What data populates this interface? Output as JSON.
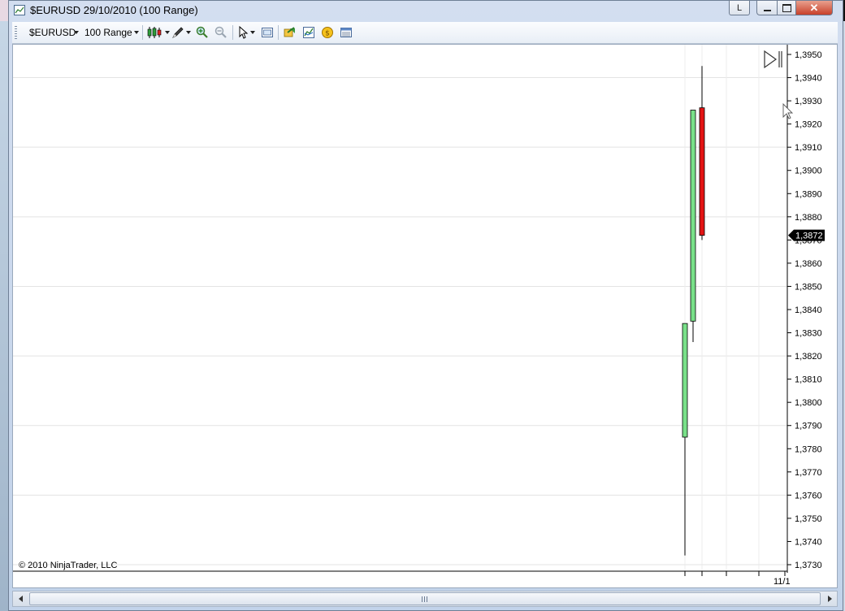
{
  "window": {
    "title": "$EURUSD  29/10/2010 (100 Range)",
    "caption_buttons": {
      "l_label": "L",
      "min_symbol": "▬",
      "max_symbol": "▢",
      "close_symbol": "✕"
    }
  },
  "toolbar": {
    "instrument": "$EURUSD",
    "period": "100 Range",
    "icons": [
      "candlestick-style-icon",
      "drawing-tool-icon",
      "zoom-in-icon",
      "zoom-out-icon",
      "pointer-icon",
      "data-box-icon",
      "strategies-icon",
      "indicators-icon",
      "coin-icon",
      "properties-icon"
    ]
  },
  "chart": {
    "copyright": "© 2010 NinjaTrader, LLC",
    "current_price_label": "1,3872",
    "date_label": "11/1",
    "colors": {
      "up": "#79e089",
      "down": "#e31414",
      "grid": "#e3e3e3",
      "wick": "#000000",
      "price_marker": "#000000"
    }
  },
  "chart_data": {
    "type": "candlestick",
    "y_axis": {
      "min": 1.373,
      "max": 1.395,
      "step": 0.001,
      "tick_labels": [
        "1,3950",
        "1,3940",
        "1,3930",
        "1,3920",
        "1,3910",
        "1,3900",
        "1,3890",
        "1,3880",
        "1,3870",
        "1,3860",
        "1,3850",
        "1,3840",
        "1,3830",
        "1,3820",
        "1,3810",
        "1,3800",
        "1,3790",
        "1,3780",
        "1,3770",
        "1,3760",
        "1,3750",
        "1,3740",
        "1,3730"
      ]
    },
    "x_axis": {
      "tick_labels": [
        "11/1"
      ]
    },
    "candles": [
      {
        "open": 1.3785,
        "high": 1.3834,
        "low": 1.3734,
        "close": 1.3834,
        "direction": "up"
      },
      {
        "open": 1.3835,
        "high": 1.3926,
        "low": 1.3826,
        "close": 1.3926,
        "direction": "up"
      },
      {
        "open": 1.3927,
        "high": 1.3945,
        "low": 1.387,
        "close": 1.3872,
        "direction": "down"
      }
    ],
    "last_price": 1.3872
  },
  "scrollbar": {
    "left_arrow": "◀",
    "right_arrow": "▶"
  }
}
